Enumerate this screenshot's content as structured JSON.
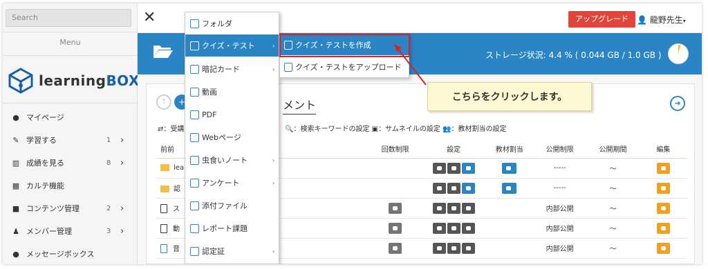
{
  "sidebar": {
    "search_placeholder": "Search",
    "menu_label": "Menu",
    "logo_text_a": "learning",
    "logo_text_b": "BOX",
    "items": [
      {
        "label": "マイページ",
        "icon": "person-icon",
        "count": "",
        "chevron": ""
      },
      {
        "label": "学習する",
        "icon": "pencil-icon",
        "count": "1",
        "chevron": "›"
      },
      {
        "label": "成績を見る",
        "icon": "chart-icon",
        "count": "8",
        "chevron": "›"
      },
      {
        "label": "カルテ機能",
        "icon": "karte-icon",
        "count": "",
        "chevron": ""
      },
      {
        "label": "コンテンツ管理",
        "icon": "folder-icon",
        "count": "2",
        "chevron": "›"
      },
      {
        "label": "メンバー管理",
        "icon": "users-icon",
        "count": "3",
        "chevron": "›"
      },
      {
        "label": "メッセージボックス",
        "icon": "chat-icon",
        "count": "",
        "chevron": ""
      }
    ]
  },
  "topbar": {
    "close_glyph": "✕",
    "upgrade_label": "アップグレード",
    "user_label": "龍野先生",
    "user_caret": "▾"
  },
  "band": {
    "storage_text": "ストレージ状況: 4.4 % ( 0.044 GB / 1.0 GB )",
    "storage_percent": 4.4
  },
  "content": {
    "doc_title": "メント",
    "next_glyph": "➜",
    "legend_left": "⇄：受講",
    "legend_right": "🔍：検索キーワードの設定  ▣：サムネイルの設定  👥：教材割当の設定",
    "columns": [
      "前前",
      "回数制限",
      "設定",
      "教材割当",
      "公開制限",
      "公開期間",
      "編集"
    ],
    "rows": [
      {
        "type": "folder",
        "name": "lea",
        "limit": false,
        "assign": true,
        "publish": "-----",
        "period": "〜"
      },
      {
        "type": "folder",
        "name": "認",
        "limit": false,
        "assign": true,
        "publish": "-----",
        "period": "〜"
      },
      {
        "type": "doc",
        "name": "ス",
        "limit": true,
        "assign": false,
        "publish": "内部公開",
        "period": "〜"
      },
      {
        "type": "doc",
        "name": "動",
        "limit": true,
        "assign": false,
        "publish": "内部公開",
        "period": "〜"
      },
      {
        "type": "doc-blue",
        "name": "音",
        "limit": true,
        "assign": false,
        "publish": "内部公開",
        "period": "〜"
      }
    ]
  },
  "dropdown": {
    "items": [
      {
        "label": "フォルダ",
        "icon": "folder-outline-icon",
        "arrow": ""
      },
      {
        "label": "クイズ・テスト",
        "icon": "quiz-icon",
        "arrow": "›",
        "active": true
      },
      {
        "label": "暗記カード",
        "icon": "card-icon",
        "arrow": "›"
      },
      {
        "label": "動画",
        "icon": "video-icon",
        "arrow": ""
      },
      {
        "label": "PDF",
        "icon": "pdf-icon",
        "arrow": ""
      },
      {
        "label": "Webページ",
        "icon": "web-icon",
        "arrow": ""
      },
      {
        "label": "虫食いノート",
        "icon": "note-icon",
        "arrow": "›"
      },
      {
        "label": "アンケート",
        "icon": "survey-icon",
        "arrow": "›"
      },
      {
        "label": "添付ファイル",
        "icon": "attach-icon",
        "arrow": ""
      },
      {
        "label": "レポート課題",
        "icon": "report-icon",
        "arrow": ""
      },
      {
        "label": "認定証",
        "icon": "certificate-icon",
        "arrow": "›"
      }
    ]
  },
  "submenu": {
    "items": [
      {
        "label": "クイズ・テストを作成",
        "icon": "create-icon",
        "active": true
      },
      {
        "label": "クイズ・テストをアップロード",
        "icon": "upload-icon",
        "active": false
      }
    ]
  },
  "callout": {
    "text": "こちらをクリックします。"
  },
  "colors": {
    "accent": "#2b85c5",
    "upgrade": "#e0463b",
    "highlight_border": "#e02020",
    "callout_bg": "#fff8d4"
  }
}
